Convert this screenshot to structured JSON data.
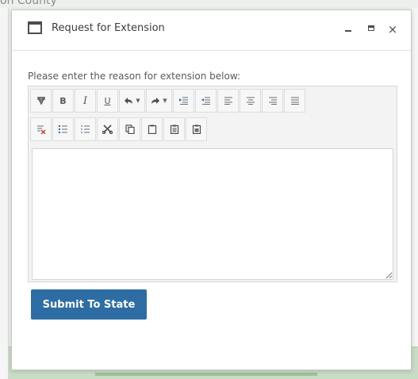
{
  "background": {
    "partial_text": "on County"
  },
  "dialog": {
    "title": "Request for Extension",
    "window_controls": {
      "minimize": "minimize-icon",
      "maximize": "maximize-icon",
      "close": "×"
    },
    "prompt": "Please enter the reason for extension below:",
    "toolbar": {
      "row1": [
        {
          "name": "clear-formatting",
          "icon": "eraser-icon"
        },
        {
          "name": "bold",
          "label": "B"
        },
        {
          "name": "italic",
          "label": "I"
        },
        {
          "name": "underline",
          "label": "U"
        },
        {
          "name": "undo",
          "icon": "undo-icon"
        },
        {
          "name": "redo",
          "icon": "redo-icon"
        },
        {
          "name": "indent",
          "icon": "indent-icon"
        },
        {
          "name": "outdent",
          "icon": "outdent-icon"
        },
        {
          "name": "align-left",
          "icon": "align-left-icon"
        },
        {
          "name": "align-center",
          "icon": "align-center-icon"
        },
        {
          "name": "align-right",
          "icon": "align-right-icon"
        },
        {
          "name": "align-justify",
          "icon": "align-justify-icon"
        }
      ],
      "row2": [
        {
          "name": "remove-format",
          "icon": "remove-format-icon"
        },
        {
          "name": "bulleted-list",
          "icon": "bulleted-list-icon"
        },
        {
          "name": "numbered-list",
          "icon": "numbered-list-icon"
        },
        {
          "name": "cut",
          "icon": "scissors-icon"
        },
        {
          "name": "copy",
          "icon": "copy-icon"
        },
        {
          "name": "paste",
          "icon": "paste-icon"
        },
        {
          "name": "paste-text",
          "icon": "paste-text-icon"
        },
        {
          "name": "paste-word",
          "icon": "paste-word-icon"
        }
      ],
      "labels": {
        "bold": "B",
        "italic": "I",
        "underline": "U"
      }
    },
    "text_value": "",
    "submit_label": "Submit To State"
  },
  "colors": {
    "accent": "#2e6da4",
    "background_green": "#c9dcc6"
  }
}
